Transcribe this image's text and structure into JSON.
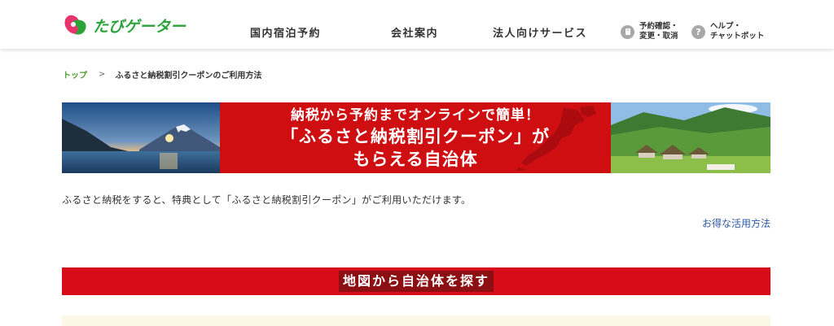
{
  "header": {
    "logo_text": "たびゲーター",
    "nav": [
      "国内宿泊予約",
      "会社案内",
      "法人向けサービス"
    ],
    "reservation": {
      "icon": "book-icon",
      "line1": "予約確認・",
      "line2": "変更・取消"
    },
    "help": {
      "icon": "question-icon",
      "glyph": "?",
      "line1": "ヘルプ・",
      "line2": "チャットボット"
    }
  },
  "breadcrumb": {
    "top": "トップ",
    "separator": ">",
    "current": "ふるさと納税割引クーポンのご利用方法"
  },
  "banner": {
    "line1": "納税から予約までオンラインで簡単！",
    "line2": "「ふるさと納税割引クーポン」が",
    "line3": "もらえる自治体"
  },
  "intro_text": "ふるさと納税をすると、特典として「ふるさと納税割引クーポン」がご利用いただけます。",
  "howto_link": "お得な活用方法",
  "section_title": "地図から自治体を探す",
  "colors": {
    "brand_green": "#2aa33a",
    "banner_red": "#cf0e12",
    "section_red": "#d70c18",
    "link_blue": "#2b58a8"
  }
}
